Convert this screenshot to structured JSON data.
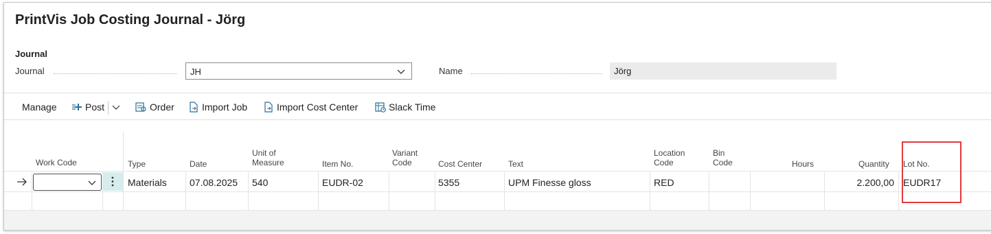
{
  "page": {
    "title": "PrintVis Job Costing Journal - Jörg"
  },
  "journal_group": {
    "caption": "Journal",
    "journal_label": "Journal",
    "journal_value": "JH",
    "name_label": "Name",
    "name_value": "Jörg"
  },
  "toolbar": {
    "manage": "Manage",
    "post": "Post",
    "order": "Order",
    "import_job": "Import Job",
    "import_cost_center": "Import Cost Center",
    "slack_time": "Slack Time"
  },
  "columns": {
    "work_code": "Work Code",
    "type": "Type",
    "date": "Date",
    "uom_1": "Unit of",
    "uom_2": "Measure",
    "item_no": "Item No.",
    "variant_1": "Variant",
    "variant_2": "Code",
    "cost_center": "Cost Center",
    "text": "Text",
    "location_1": "Location",
    "location_2": "Code",
    "bin_1": "Bin",
    "bin_2": "Code",
    "hours": "Hours",
    "quantity": "Quantity",
    "lot_no": "Lot No."
  },
  "rows": [
    {
      "work_code": "",
      "type": "Materials",
      "date": "07.08.2025",
      "uom": "540",
      "item_no": "EUDR-02",
      "variant": "",
      "cost_center": "5355",
      "text": "UPM Finesse gloss",
      "location": "RED",
      "bin": "",
      "hours": "",
      "quantity": "2.200,00",
      "lot_no": "EUDR17"
    }
  ],
  "colors": {
    "accent": "#00707a",
    "highlight_border": "#e03a3a",
    "kebab_bg": "#d7eced"
  },
  "icons": {
    "post": "post-icon",
    "order": "order-icon",
    "import_job": "import-job-icon",
    "import_cost_center": "import-cost-center-icon",
    "slack_time": "slack-time-icon",
    "row_indicator": "arrow-right-icon"
  }
}
